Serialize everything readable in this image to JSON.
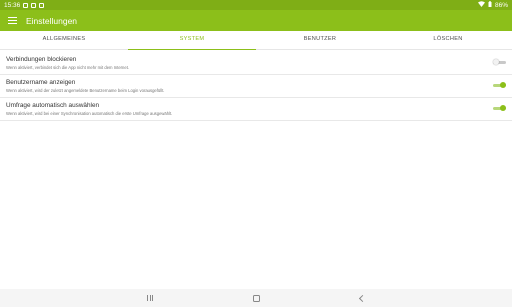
{
  "status_bar": {
    "time": "15:36",
    "battery": "86%"
  },
  "app_bar": {
    "title": "Einstellungen"
  },
  "tabs": [
    {
      "label": "ALLGEMEINES",
      "active": false
    },
    {
      "label": "SYSTEM",
      "active": true
    },
    {
      "label": "BENUTZER",
      "active": false
    },
    {
      "label": "LÖSCHEN",
      "active": false
    }
  ],
  "settings": [
    {
      "title": "Verbindungen blockieren",
      "description": "Wenn aktiviert, verbindet sich die App nicht mehr mit dem Internet.",
      "enabled": false
    },
    {
      "title": "Benutzername anzeigen",
      "description": "Wenn aktiviert, wird der zuletzt angemeldete Benutzername beim Login vorausgefüllt.",
      "enabled": true
    },
    {
      "title": "Umfrage automatisch auswählen",
      "description": "Wenn aktiviert, wird bei einer Synchronisation automatisch die erste Umfrage ausgewählt.",
      "enabled": true
    }
  ],
  "colors": {
    "accent": "#8cbf1a",
    "status_bar": "#7fae16"
  },
  "icons": {
    "menu": "menu-icon",
    "wifi": "wifi-icon",
    "battery": "battery-icon"
  }
}
